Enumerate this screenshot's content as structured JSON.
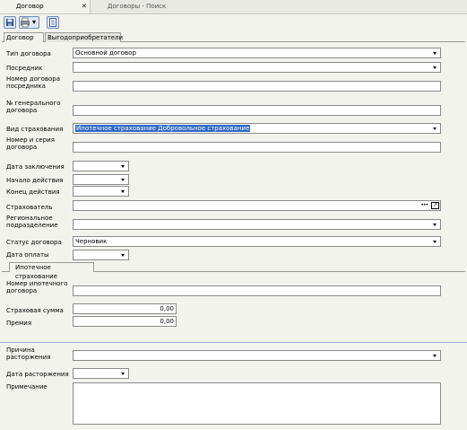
{
  "tabs": {
    "active": "Договор",
    "inactive": "Договоры - Поиск",
    "close_glyph": "✕"
  },
  "toolbar": {
    "icons": [
      "save-icon",
      "print-icon",
      "document-icon"
    ],
    "dropdown_glyph": "▾"
  },
  "page_tabs": [
    "Договор",
    "Выгодоприобретатели"
  ],
  "form": {
    "contract_type": {
      "label": "Тип договора",
      "value": "Основной договор"
    },
    "intermediary": {
      "label": "Посредник",
      "value": ""
    },
    "intermediary_contract_no": {
      "label": "Номер договора\nпосредника",
      "value": ""
    },
    "general_contract_no": {
      "label": "№ генерального\nдоговора",
      "value": ""
    },
    "insurance_type": {
      "label": "Вид страхования",
      "value": "Ипотечное страхование Добровольное страхование"
    },
    "contract_number_series": {
      "label": "Номер и серия\nдоговора",
      "value": ""
    },
    "conclusion_date": {
      "label": "Дата заключения",
      "value": ""
    },
    "start_date": {
      "label": "Начало действия",
      "value": ""
    },
    "end_date": {
      "label": "Конец действия",
      "value": ""
    },
    "policyholder": {
      "label": "Страхователь",
      "value": "",
      "ellipsis": "•••",
      "open_glyph": "↗"
    },
    "regional_unit": {
      "label": "Региональное\nподразделение",
      "value": ""
    },
    "contract_status": {
      "label": "Статус договора",
      "value": "Черновик"
    },
    "payment_date": {
      "label": "Дата оплаты",
      "value": ""
    }
  },
  "mortgage": {
    "tab": "Ипотечное страхование",
    "mortgage_contract_no": {
      "label": "Номер ипотечного\nдоговора",
      "value": ""
    },
    "sum_insured": {
      "label": "Страховая сумма",
      "value": "0,00"
    },
    "premium": {
      "label": "Премия",
      "value": "0,00"
    }
  },
  "termination": {
    "reason": {
      "label": "Причина\nрасторжения",
      "value": ""
    },
    "date": {
      "label": "Дата расторжения",
      "value": ""
    },
    "note": {
      "label": "Примечание",
      "value": ""
    }
  },
  "colors": {
    "accent": "#3169c6",
    "border": "#8a8a8a",
    "background": "#f3f3ee",
    "selection": "#3169c6"
  }
}
